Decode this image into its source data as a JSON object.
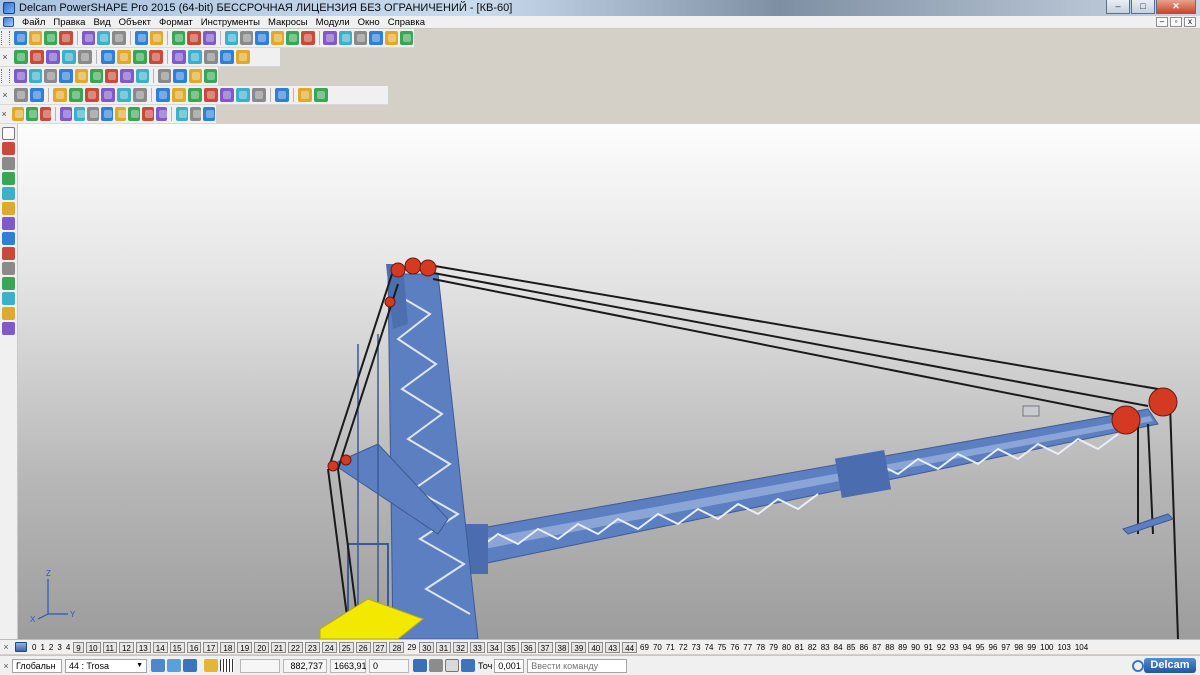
{
  "window": {
    "title": "Delcam PowerSHAPE Pro 2015 (64-bit) БЕССРОЧНАЯ ЛИЦЕНЗИЯ БЕЗ ОГРАНИЧЕНИЙ - [КВ-60]",
    "minimize": "‒",
    "maximize": "□",
    "close": "✕"
  },
  "menu": {
    "items": [
      "Файл",
      "Правка",
      "Вид",
      "Объект",
      "Формат",
      "Инструменты",
      "Макросы",
      "Модули",
      "Окно",
      "Справка"
    ],
    "mdi_minimize": "–",
    "mdi_restore": "▫",
    "mdi_close": "x"
  },
  "toolbars": {
    "close_glyph": "×",
    "colors": [
      "#2f7fd4",
      "#e0a92c",
      "#3aa655",
      "#c74a3a",
      "#7f5ac8",
      "#3cb0c8",
      "#8a8a8a"
    ]
  },
  "levels": {
    "items": [
      "0",
      "1",
      "2",
      "3",
      "4",
      "9",
      "10",
      "11",
      "12",
      "13",
      "14",
      "15",
      "16",
      "17",
      "18",
      "19",
      "20",
      "21",
      "22",
      "23",
      "24",
      "25",
      "26",
      "27",
      "28",
      "29",
      "30",
      "31",
      "32",
      "33",
      "34",
      "35",
      "36",
      "37",
      "38",
      "39",
      "40",
      "43",
      "44",
      "69",
      "70",
      "71",
      "72",
      "73",
      "74",
      "75",
      "76",
      "77",
      "78",
      "79",
      "80",
      "81",
      "82",
      "83",
      "84",
      "85",
      "86",
      "87",
      "88",
      "89",
      "90",
      "91",
      "92",
      "93",
      "94",
      "95",
      "96",
      "97",
      "98",
      "99",
      "100",
      "103",
      "104"
    ],
    "boxed": [
      "9",
      "10",
      "11",
      "12",
      "13",
      "14",
      "15",
      "16",
      "17",
      "18",
      "19",
      "20",
      "21",
      "22",
      "23",
      "24",
      "25",
      "26",
      "27",
      "28",
      "30",
      "31",
      "32",
      "33",
      "34",
      "35",
      "36",
      "37",
      "38",
      "39",
      "40",
      "43",
      "44"
    ]
  },
  "status": {
    "workplane": "Глобальн",
    "level": "44 : Trosa",
    "x": "882,737",
    "y": "1663,91",
    "z": "0",
    "tolerance_label": "Точ",
    "tolerance_value": "0,001",
    "command_placeholder": "Ввести команду",
    "brand": "Delcam"
  },
  "viewport": {
    "axis_labels": {
      "x": "X",
      "y": "Y",
      "z": "Z"
    },
    "colors": {
      "steel": "#5b7fc0",
      "steel_dark": "#3d5a94",
      "pulley": "#d43a22",
      "cable": "#1a1a1a",
      "cab": "#f2e800"
    }
  }
}
